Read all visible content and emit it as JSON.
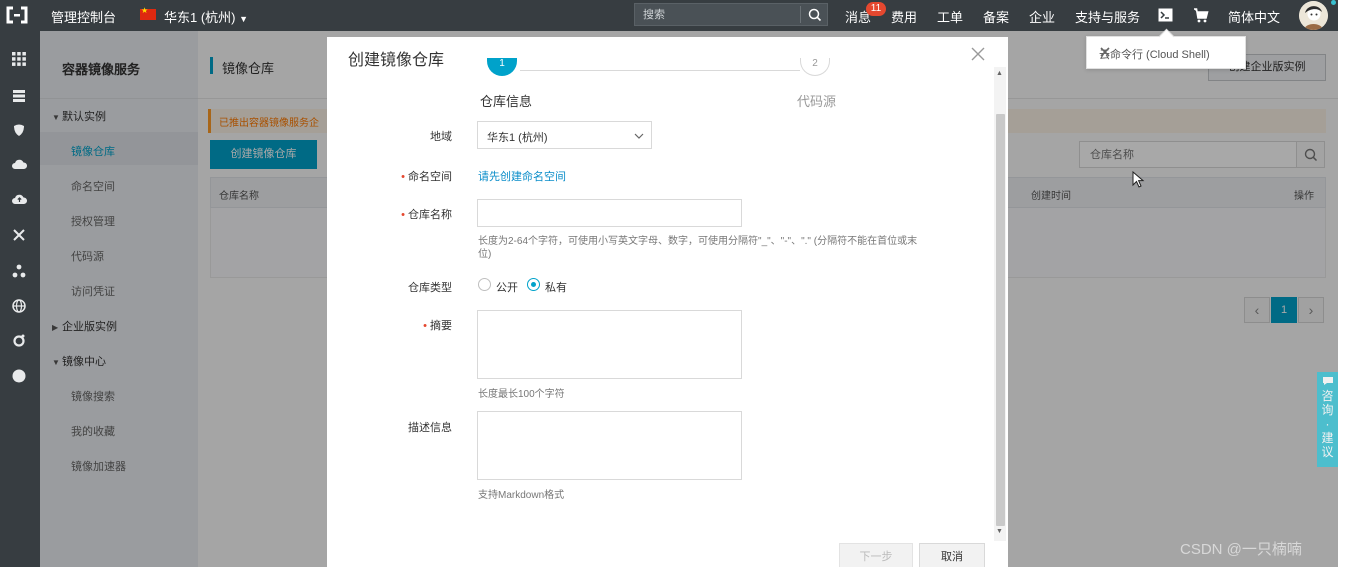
{
  "topbar": {
    "console": "管理控制台",
    "region": "华东1 (杭州)",
    "search_placeholder": "搜索",
    "messages": "消息",
    "messages_badge": "11",
    "billing": "费用",
    "tickets": "工单",
    "icp": "备案",
    "enterprise": "企业",
    "support": "支持与服务",
    "language": "简体中文"
  },
  "cloud_shell_tip": {
    "text": "云命令行 (Cloud Shell)"
  },
  "sidebar": {
    "title": "容器镜像服务",
    "default_instance": "默认实例",
    "items_default": [
      "镜像仓库",
      "命名空间",
      "授权管理",
      "代码源",
      "访问凭证"
    ],
    "enterprise_instance": "企业版实例",
    "image_center": "镜像中心",
    "items_center": [
      "镜像搜索",
      "我的收藏",
      "镜像加速器"
    ]
  },
  "main": {
    "breadcrumb": "镜像仓库",
    "notice": "已推出容器镜像服务企",
    "create_button": "创建镜像仓库",
    "create_enterprise_button": "创建企业版实例",
    "search_placeholder": "仓库名称",
    "col_name": "仓库名称",
    "col_created": "创建时间",
    "col_actions": "操作",
    "page_current": "1"
  },
  "modal": {
    "title": "创建镜像仓库",
    "step1_num": "1",
    "step2_num": "2",
    "step1_label": "仓库信息",
    "step2_label": "代码源",
    "region_label": "地域",
    "region_value": "华东1 (杭州)",
    "namespace_label": "命名空间",
    "namespace_link": "请先创建命名空间",
    "repo_name_label": "仓库名称",
    "repo_name_hint": "长度为2-64个字符，可使用小写英文字母、数字，可使用分隔符\"_\"、\"-\"、\".\" (分隔符不能在首位或末位)",
    "repo_type_label": "仓库类型",
    "type_public": "公开",
    "type_private": "私有",
    "summary_label": "摘要",
    "summary_hint": "长度最长100个字符",
    "desc_label": "描述信息",
    "desc_hint": "支持Markdown格式",
    "next_button": "下一步",
    "cancel_button": "取消"
  },
  "feedback": "咨询·建议",
  "watermark": "CSDN @一只楠喃",
  "colors": {
    "accent": "#00a2ca",
    "topbar": "#373d41",
    "required": "#e5482f"
  }
}
